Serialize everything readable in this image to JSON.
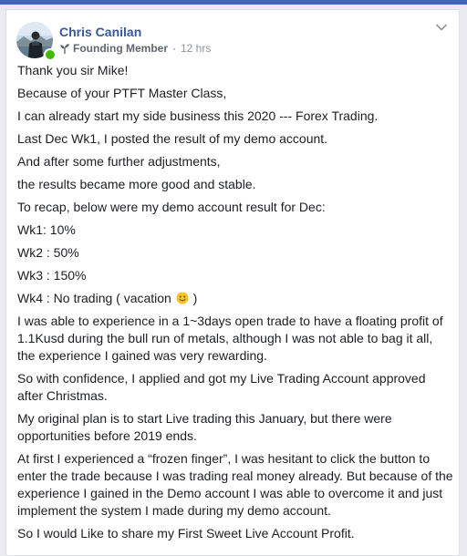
{
  "post": {
    "author": "Chris Canilan",
    "badge": "Founding Member",
    "separator": "·",
    "time": "12 hrs",
    "paragraphs": [
      "Thank you sir Mike!",
      "Because of your PTFT Master Class,",
      "I can already start my side business this 2020 --- Forex Trading.",
      "Last Dec Wk1, I posted the result of my demo account.",
      "And after some further adjustments,",
      "the results became more good and stable.",
      "To recap, below were my demo account result for Dec:",
      "Wk1: 10%",
      "Wk2 : 50%",
      "Wk3 : 150%"
    ],
    "wk4_text": "Wk4 : No trading ( vacation",
    "wk4_close": " )",
    "paragraphs_after": [
      "I was able to experience in a 1~3days open trade to have a floating profit of 1.1Kusd during the bull run of metals, although I was not able to bag it all, the experience I gained was very rewarding.",
      "So with confidence, I applied and got my Live Trading Account approved after Christmas.",
      "My original plan is to start Live trading this January, but there were opportunities before 2019 ends.",
      "At first I experienced a “frozen finger”, I was hesitant to click the button to enter the trade because I was trading real money already. But because of the experience I gained in the Demo account I was able to overcome it and just implement the system I made during my demo account.",
      "So I would Like to share my First Sweet Live Account Profit."
    ]
  },
  "colors": {
    "author_link": "#385898",
    "body_text": "#1c1e21",
    "meta_text": "#606770",
    "online": "#44b700",
    "page_bg": "#e9ebee",
    "topbar": "#4267b2"
  },
  "icons": {
    "member_badge": "sprout-icon",
    "menu": "chevron-down-icon",
    "emoji": "smiley-emoji-icon"
  }
}
